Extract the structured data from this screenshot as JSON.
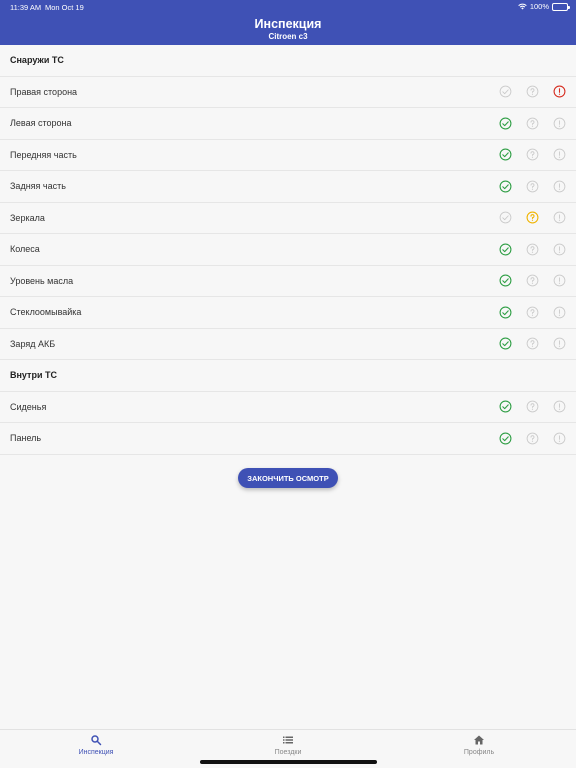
{
  "status_bar": {
    "time": "11:39 AM",
    "date": "Mon Oct 19",
    "battery": "100%"
  },
  "header": {
    "title": "Инспекция",
    "subtitle": "Citroen c3"
  },
  "sections": [
    {
      "title": "Снаружи ТС",
      "items": [
        {
          "label": "Правая сторона",
          "state": [
            "ok-inactive",
            "question-inactive",
            "alert-active"
          ]
        },
        {
          "label": "Левая сторона",
          "state": [
            "ok-active",
            "question-inactive",
            "info-inactive"
          ]
        },
        {
          "label": "Передняя часть",
          "state": [
            "ok-active",
            "question-inactive",
            "info-inactive"
          ]
        },
        {
          "label": "Задняя часть",
          "state": [
            "ok-active",
            "question-inactive",
            "info-inactive"
          ]
        },
        {
          "label": "Зеркала",
          "state": [
            "ok-inactive",
            "question-active",
            "info-inactive"
          ]
        },
        {
          "label": "Колеса",
          "state": [
            "ok-active",
            "question-inactive",
            "info-inactive"
          ]
        },
        {
          "label": "Уровень масла",
          "state": [
            "ok-active",
            "question-inactive",
            "info-inactive"
          ]
        },
        {
          "label": "Стеклоомывайка",
          "state": [
            "ok-active",
            "question-inactive",
            "info-inactive"
          ]
        },
        {
          "label": "Заряд АКБ",
          "state": [
            "ok-active",
            "question-inactive",
            "info-inactive"
          ]
        }
      ]
    },
    {
      "title": "Внутри ТС",
      "items": [
        {
          "label": "Сиденья",
          "state": [
            "ok-active",
            "question-inactive",
            "info-inactive"
          ]
        },
        {
          "label": "Панель",
          "state": [
            "ok-active",
            "question-inactive",
            "info-inactive"
          ]
        }
      ]
    }
  ],
  "finish_button": "ЗАКОНЧИТЬ ОСМОТР",
  "tabs": [
    {
      "label": "Инспекция",
      "icon": "search-icon",
      "active": true
    },
    {
      "label": "Поездки",
      "icon": "list-icon",
      "active": false
    },
    {
      "label": "Профиль",
      "icon": "home-icon",
      "active": false
    }
  ],
  "colors": {
    "primary": "#3f51b5",
    "ok": "#2e9e44",
    "question": "#f0b400",
    "alert": "#d62d20",
    "inactive": "#c9c9c9"
  }
}
